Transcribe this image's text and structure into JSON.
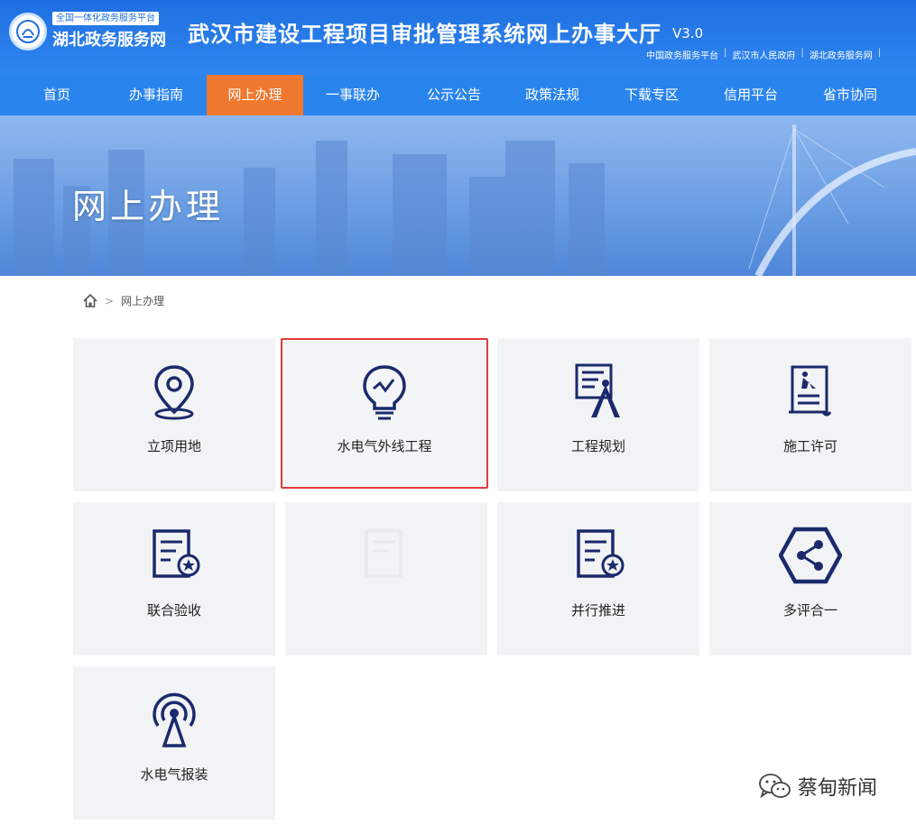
{
  "header": {
    "logo_small": "全国一体化政务服务平台",
    "logo_big": "湖北政务服务网",
    "title": "武汉市建设工程项目审批管理系统网上办事大厅",
    "version": "V3.0",
    "links": [
      "中国政务服务平台",
      "武汉市人民政府",
      "湖北政务服务网"
    ]
  },
  "nav": {
    "items": [
      "首页",
      "办事指南",
      "网上办理",
      "一事联办",
      "公示公告",
      "政策法规",
      "下载专区",
      "信用平台",
      "省市协同"
    ],
    "active_index": 2,
    "active_color": "#f0782f"
  },
  "banner": {
    "title": "网上办理"
  },
  "breadcrumb": {
    "home_icon": "home-icon",
    "current": "网上办理"
  },
  "tiles": [
    {
      "label": "立项用地",
      "icon": "location-pin-icon"
    },
    {
      "label": "水电气外线工程",
      "icon": "lightbulb-icon",
      "selected": true
    },
    {
      "label": "工程规划",
      "icon": "drafting-compass-icon"
    },
    {
      "label": "施工许可",
      "icon": "construction-document-icon"
    },
    {
      "label": "联合验收",
      "icon": "document-star-icon"
    },
    {
      "label": "",
      "icon": "document-faded-icon"
    },
    {
      "label": "并行推进",
      "icon": "document-star-icon"
    },
    {
      "label": "多评合一",
      "icon": "share-hexagon-icon"
    },
    {
      "label": "水电气报装",
      "icon": "signal-tower-icon"
    }
  ],
  "colors": {
    "header_blue": "#1f6fe0",
    "nav_blue": "#2a84ee",
    "icon_navy": "#1a2a6c",
    "selection_red": "#e23b3b"
  },
  "watermark": {
    "text": "蔡甸新闻",
    "icon": "wechat-icon"
  }
}
